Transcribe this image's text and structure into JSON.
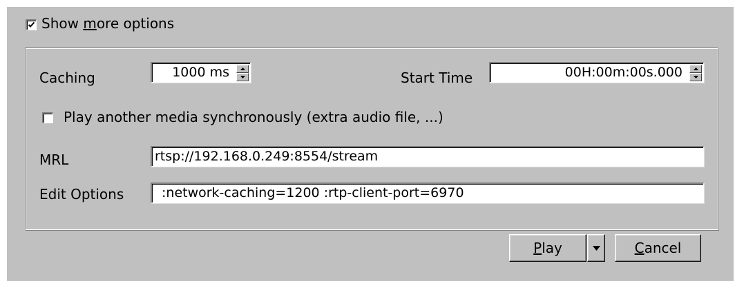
{
  "show_more": {
    "checked": true,
    "label_pre": "Show ",
    "label_mnemonic": "m",
    "label_post": "ore options"
  },
  "caching": {
    "label": "Caching",
    "value": "1000 ms"
  },
  "start_time": {
    "label": "Start Time",
    "value": "00H:00m:00s.000"
  },
  "sync_media": {
    "checked": false,
    "label": "Play another media synchronously (extra audio file, ...)"
  },
  "mrl": {
    "label": "MRL",
    "value": "rtsp://192.168.0.249:8554/stream"
  },
  "edit_options": {
    "label": "Edit Options",
    "value": ":network-caching=1200 :rtp-client-port=6970"
  },
  "buttons": {
    "play_mnemonic": "P",
    "play_rest": "lay",
    "cancel_mnemonic": "C",
    "cancel_rest": "ancel"
  },
  "icons": {
    "check": "checkmark-icon",
    "spin_up": "spin-up-arrow-icon",
    "spin_down": "spin-down-arrow-icon",
    "dropdown": "dropdown-arrow-icon"
  },
  "colors": {
    "dialog_bg": "#c0c0c0",
    "field_bg": "#ffffff"
  }
}
